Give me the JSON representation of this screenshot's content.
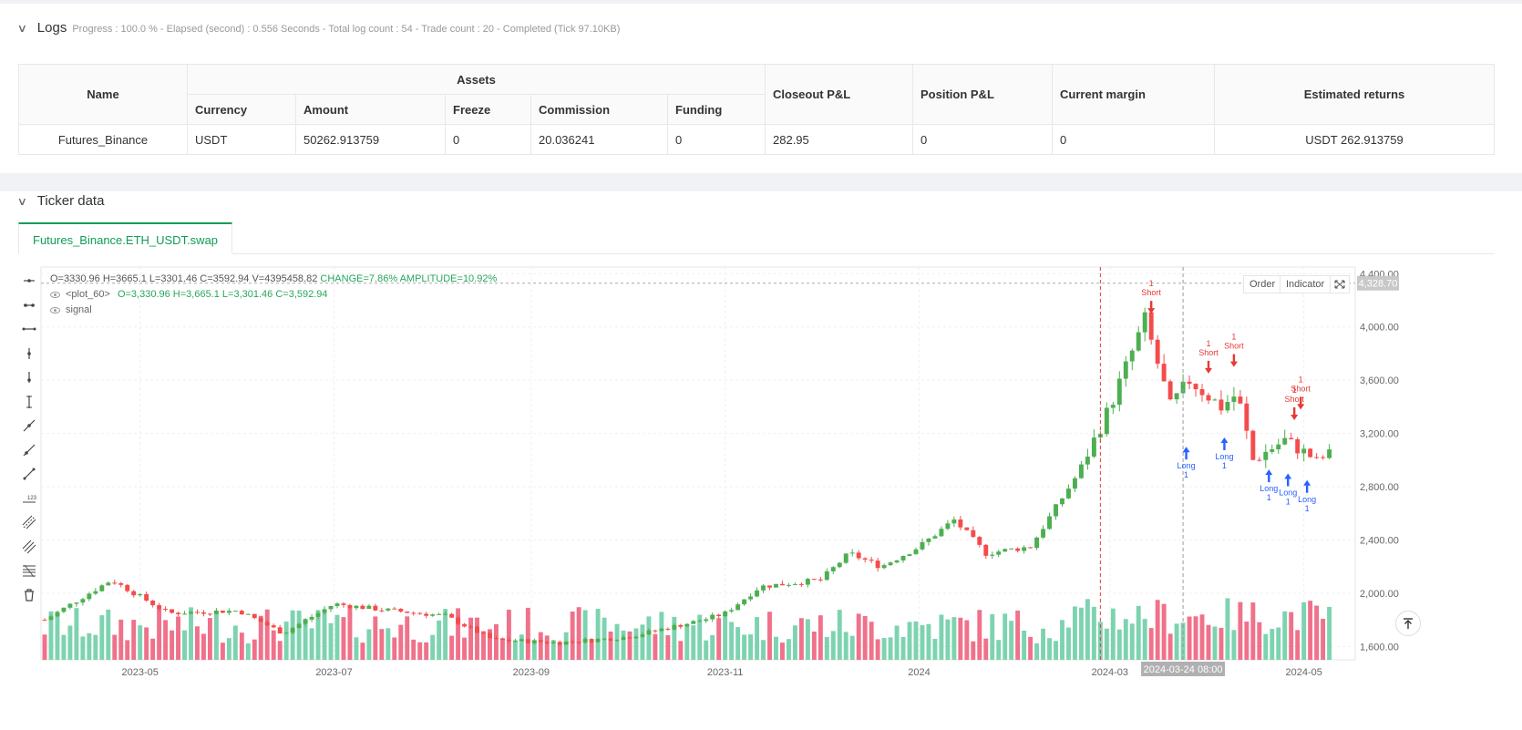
{
  "logs": {
    "title": "Logs",
    "meta": "Progress : 100.0 % - Elapsed (second) : 0.556  Seconds - Total log count : 54 - Trade count : 20 - Completed (Tick 97.10KB)"
  },
  "assets_table": {
    "headers": {
      "name": "Name",
      "assets": "Assets",
      "currency": "Currency",
      "amount": "Amount",
      "freeze": "Freeze",
      "commission": "Commission",
      "funding": "Funding",
      "closeout": "Closeout P&L",
      "position": "Position P&L",
      "margin": "Current margin",
      "returns": "Estimated returns"
    },
    "row": {
      "name": "Futures_Binance",
      "currency": "USDT",
      "amount": "50262.913759",
      "freeze": "0",
      "commission": "20.036241",
      "funding": "0",
      "closeout": "282.95",
      "position": "0",
      "margin": "0",
      "returns": "USDT 262.913759"
    }
  },
  "ticker": {
    "title": "Ticker data",
    "tab": "Futures_Binance.ETH_USDT.swap",
    "ohlc_line": {
      "o": "O=3330.96",
      "h": "H=3665.1",
      "l": "L=3301.46",
      "c": "C=3592.94",
      "v": "V=4395458.82",
      "change": "CHANGE=7.86%",
      "amp": "AMPLITUDE=10.92%"
    },
    "plot_legend": {
      "name": "<plot_60>",
      "values": "O=3,330.96  H=3,665.1  L=3,301.46  C=3,592.94"
    },
    "signal_legend": "signal",
    "buttons": {
      "order": "Order",
      "indicator": "Indicator"
    },
    "crosshair_date": "2024-03-24 08:00",
    "last_price": "4,328.70",
    "colors": {
      "up": "#4caf50",
      "down": "#f44c4c",
      "vol_up": "#7dd3b0",
      "vol_down": "#f0718a",
      "long": "#2962ff",
      "short": "#e53935"
    }
  },
  "chart_data": {
    "type": "candlestick",
    "symbol": "Futures_Binance.ETH_USDT.swap",
    "y_ticks": [
      "1,600.00",
      "2,000.00",
      "2,400.00",
      "2,800.00",
      "3,200.00",
      "3,600.00",
      "4,000.00",
      "4,400.00"
    ],
    "x_ticks": [
      "2023-05",
      "2023-07",
      "2023-09",
      "2023-11",
      "2024",
      "2024-03",
      "2024-05"
    ],
    "ylim": [
      1500,
      4450
    ],
    "price_anchors": [
      [
        "2023-04-01",
        1800
      ],
      [
        "2023-04-15",
        2000
      ],
      [
        "2023-04-22",
        2100
      ],
      [
        "2023-05-10",
        1850
      ],
      [
        "2023-06-01",
        1870
      ],
      [
        "2023-06-15",
        1700
      ],
      [
        "2023-07-01",
        1920
      ],
      [
        "2023-07-15",
        1880
      ],
      [
        "2023-08-05",
        1830
      ],
      [
        "2023-08-20",
        1650
      ],
      [
        "2023-09-10",
        1630
      ],
      [
        "2023-10-01",
        1670
      ],
      [
        "2023-10-25",
        1800
      ],
      [
        "2023-11-01",
        1850
      ],
      [
        "2023-11-12",
        2050
      ],
      [
        "2023-12-01",
        2100
      ],
      [
        "2023-12-10",
        2300
      ],
      [
        "2023-12-20",
        2200
      ],
      [
        "2024-01-01",
        2350
      ],
      [
        "2024-01-12",
        2550
      ],
      [
        "2024-01-22",
        2300
      ],
      [
        "2024-02-05",
        2350
      ],
      [
        "2024-02-20",
        2900
      ],
      [
        "2024-03-01",
        3400
      ],
      [
        "2024-03-12",
        4050
      ],
      [
        "2024-03-20",
        3400
      ],
      [
        "2024-03-26",
        3600
      ],
      [
        "2024-04-05",
        3400
      ],
      [
        "2024-04-10",
        3500
      ],
      [
        "2024-04-15",
        3000
      ],
      [
        "2024-04-25",
        3150
      ],
      [
        "2024-05-05",
        3000
      ],
      [
        "2024-05-10",
        3050
      ]
    ],
    "signals": [
      {
        "type": "Short",
        "qty": "1",
        "date": "2024-03-14",
        "price": 4100
      },
      {
        "type": "Short",
        "qty": "1",
        "date": "2024-04-01",
        "price": 3650
      },
      {
        "type": "Short",
        "qty": "1",
        "date": "2024-04-09",
        "price": 3700
      },
      {
        "type": "Short",
        "qty": "1",
        "date": "2024-04-28",
        "price": 3300
      },
      {
        "type": "Short",
        "qty": "1",
        "date": "2024-04-30",
        "price": 3380
      },
      {
        "type": "Long",
        "qty": "1",
        "date": "2024-03-25",
        "price": 3100
      },
      {
        "type": "Long",
        "qty": "1",
        "date": "2024-04-06",
        "price": 3170
      },
      {
        "type": "Long",
        "qty": "1",
        "date": "2024-04-20",
        "price": 2930
      },
      {
        "type": "Long",
        "qty": "1",
        "date": "2024-04-26",
        "price": 2900
      },
      {
        "type": "Long",
        "qty": "1",
        "date": "2024-05-02",
        "price": 2850
      }
    ]
  }
}
